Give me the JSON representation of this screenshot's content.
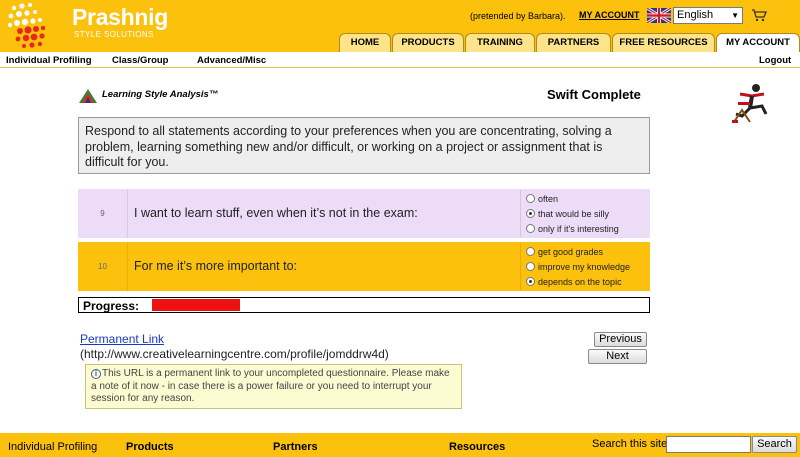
{
  "header": {
    "brand": "Prashnig",
    "brand_sub": "STYLE SOLUTIONS",
    "pretended_by": "(pretended by Barbara).",
    "my_account_link": "MY ACCOUNT",
    "language": "English",
    "tabs": [
      {
        "label": "HOME"
      },
      {
        "label": "PRODUCTS"
      },
      {
        "label": "TRAINING"
      },
      {
        "label": "PARTNERS"
      },
      {
        "label": "FREE RESOURCES"
      },
      {
        "label": "MY ACCOUNT"
      }
    ]
  },
  "subnav": {
    "items": [
      "Individual Profiling",
      "Class/Group",
      "Advanced/Misc"
    ],
    "logout": "Logout"
  },
  "content": {
    "logo_text": "Learning Style Analysis™",
    "title": "Swift Complete",
    "instructions": "Respond to all statements according to your preferences when you are concentrating, solving a problem, learning something new and/or difficult, or working on a project or assignment that is difficult for you.",
    "questions": [
      {
        "number": "9",
        "text": "I want to learn stuff, even when it’s not in the exam:",
        "options": [
          "often",
          "that would be silly",
          "only if it's interesting"
        ],
        "selected": 1
      },
      {
        "number": "10",
        "text": "For me it’s more important to:",
        "options": [
          "get good grades",
          "improve my knowledge",
          "depends on the topic"
        ],
        "selected": 2
      }
    ],
    "progress_label": "Progress:",
    "progress_fraction": 0.18,
    "permanent_link_label": "Permanent Link",
    "permanent_link_url": "(http://www.creativelearningcentre.com/profile/jomddrw4d)",
    "previous_label": "Previous",
    "next_label": "Next",
    "note": "This URL is a permanent link to your uncompleted questionnaire. Please make a note of it now - in case there is a power failure or you need to interrupt your session for any reason."
  },
  "footer": {
    "links": [
      "Individual Profiling",
      "Products",
      "Partners",
      "Resources"
    ],
    "search_label": "Search this site:",
    "search_button": "Search",
    "search_value": ""
  },
  "colors": {
    "brand_yellow": "#fcc10d",
    "question_alt_bg": "#ecdcf8",
    "progress_fill": "#ee1111",
    "link_blue": "#1a3ac0"
  }
}
